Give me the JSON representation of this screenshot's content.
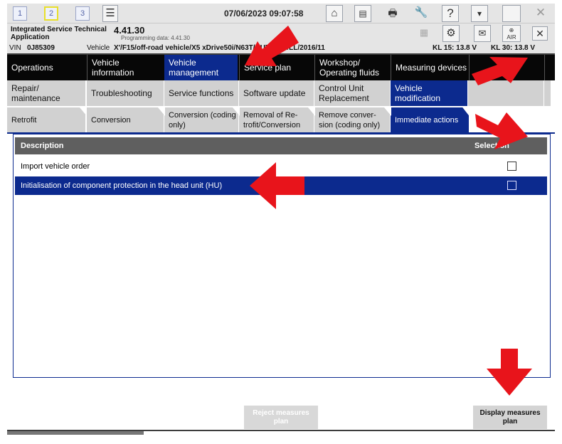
{
  "toolbar": {
    "screen_buttons": [
      "1",
      "2",
      "3"
    ],
    "datetime": "07/06/2023 09:07:58",
    "icons": [
      "list-icon",
      "home-icon",
      "dialog-icon",
      "printer-icon",
      "wrench-icon",
      "help-icon",
      "minimize-icon",
      "maximize-icon",
      "close-icon"
    ]
  },
  "header": {
    "app_name_line1": "Integrated Service Technical",
    "app_name_line2": "Application",
    "version": "4.41.30",
    "programming_data": "Programming data:  4.41.30",
    "vin_label": "VIN",
    "vin": "0J85309",
    "vehicle_label": "Vehicle",
    "vehicle": "X'/F15/off-road vehicle/X5 xDrive50i/N63T/AUTO/US/LL/2016/11",
    "kl15": "KL 15:  13.8 V",
    "kl30": "KL 30:  13.8 V"
  },
  "nav_main": [
    {
      "label": "Operations"
    },
    {
      "label": "Vehicle information"
    },
    {
      "label": "Vehicle management"
    },
    {
      "label": "Service plan"
    },
    {
      "label": "Workshop/ Operating fluids"
    },
    {
      "label": "Measuring devices"
    }
  ],
  "nav_sub": [
    {
      "label": "Repair/ maintenance"
    },
    {
      "label": "Troubleshooting"
    },
    {
      "label": "Service functions"
    },
    {
      "label": "Software update"
    },
    {
      "label": "Control Unit Replacement"
    },
    {
      "label": "Vehicle modification"
    }
  ],
  "nav_tabs": [
    {
      "label": "Retrofit"
    },
    {
      "label": "Conversion"
    },
    {
      "label": "Conversion (coding only)"
    },
    {
      "label": "Removal of Re-trofit/Conversion"
    },
    {
      "label": "Remove conver-sion (coding only)"
    },
    {
      "label": "Immediate actions"
    }
  ],
  "table": {
    "columns": [
      "Description",
      "Selection"
    ],
    "rows": [
      {
        "description": "Import vehicle order",
        "selected": false
      },
      {
        "description": "Initialisation of component protection in the head unit (HU)",
        "selected": true
      }
    ]
  },
  "buttons": {
    "reject_line1": "Reject measures",
    "reject_line2": "plan",
    "display_line1": "Display measures",
    "display_line2": "plan"
  },
  "colors": {
    "selected_blue": "#0c2a8e",
    "arrow_red": "#e8141b",
    "header_dark": "#070707"
  }
}
